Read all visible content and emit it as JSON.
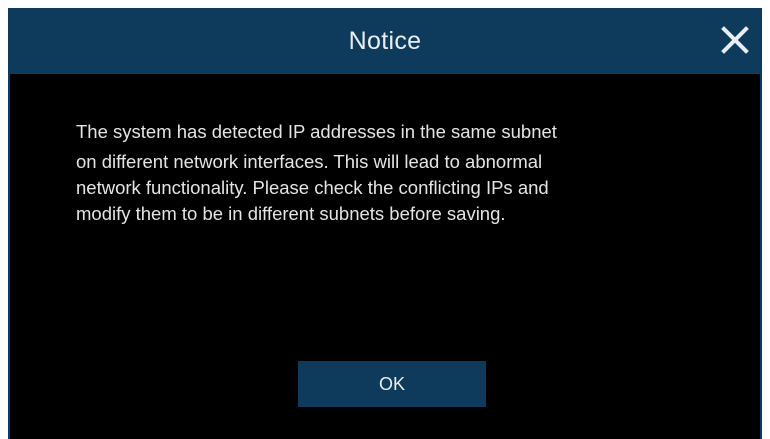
{
  "dialog": {
    "title": "Notice",
    "close_icon": "close-icon",
    "message_lines": [
      "The system has detected IP addresses in the same subnet",
      "on different network interfaces. This will lead to abnormal",
      "network functionality. Please check the conflicting IPs and",
      "modify them to be in different subnets before saving."
    ],
    "ok_label": "OK"
  },
  "colors": {
    "titlebar": "#0e3a5c",
    "background": "#000000",
    "text": "#e4e4e4"
  }
}
